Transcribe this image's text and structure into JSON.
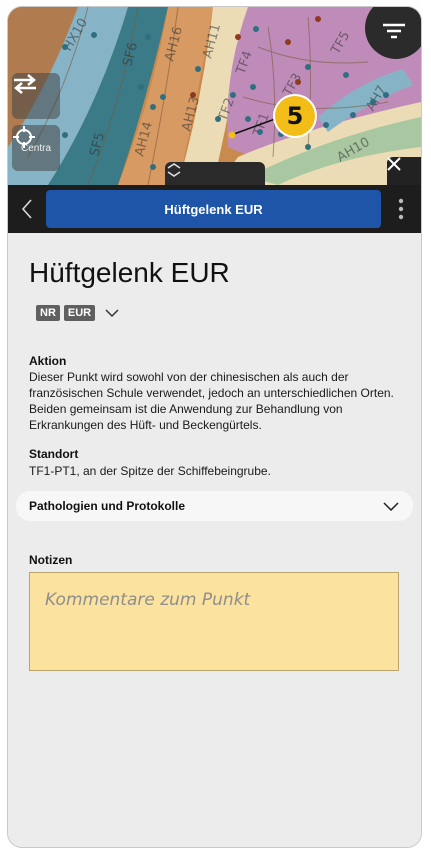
{
  "map": {
    "region_labels": [
      "HX10",
      "SF6",
      "AH16",
      "AH11",
      "TF4",
      "TF5",
      "AH13",
      "TF2",
      "TF3",
      "AH14",
      "SF5",
      "AH7",
      "AH10",
      "TF1"
    ],
    "point_number": "5",
    "centra_label": "Centra",
    "colors": {
      "skin": "#c98a4d",
      "band_blue": "#86b4c6",
      "band_purple": "#bf8cba",
      "band_cream": "#ecdcb6",
      "band_green": "#a9c8a2",
      "dot_blue": "#2f6f80",
      "dot_red": "#8e3a1f",
      "marker": "#f2bd16"
    }
  },
  "header": {
    "back_icon": "chevron-left-icon",
    "title": "Hüftgelenk EUR",
    "more_icon": "vertical-dots-icon"
  },
  "point": {
    "title": "Hüftgelenk EUR",
    "tags": [
      "NR",
      "EUR"
    ],
    "aktion_label": "Aktion",
    "aktion_text": "Dieser Punkt wird sowohl von der chinesischen als auch der französischen Schule verwendet, jedoch an unterschiedlichen Orten. Beiden gemeinsam ist die Anwendung zur Behandlung von Erkrankungen des Hüft- und Beckengürtels.",
    "standort_label": "Standort",
    "standort_text": "TF1-PT1, an der Spitze der Schiffebeingrube."
  },
  "accordion": {
    "label": "Pathologien und Protokolle"
  },
  "notes": {
    "label": "Notizen",
    "placeholder": "Kommentare zum Punkt",
    "value": ""
  }
}
